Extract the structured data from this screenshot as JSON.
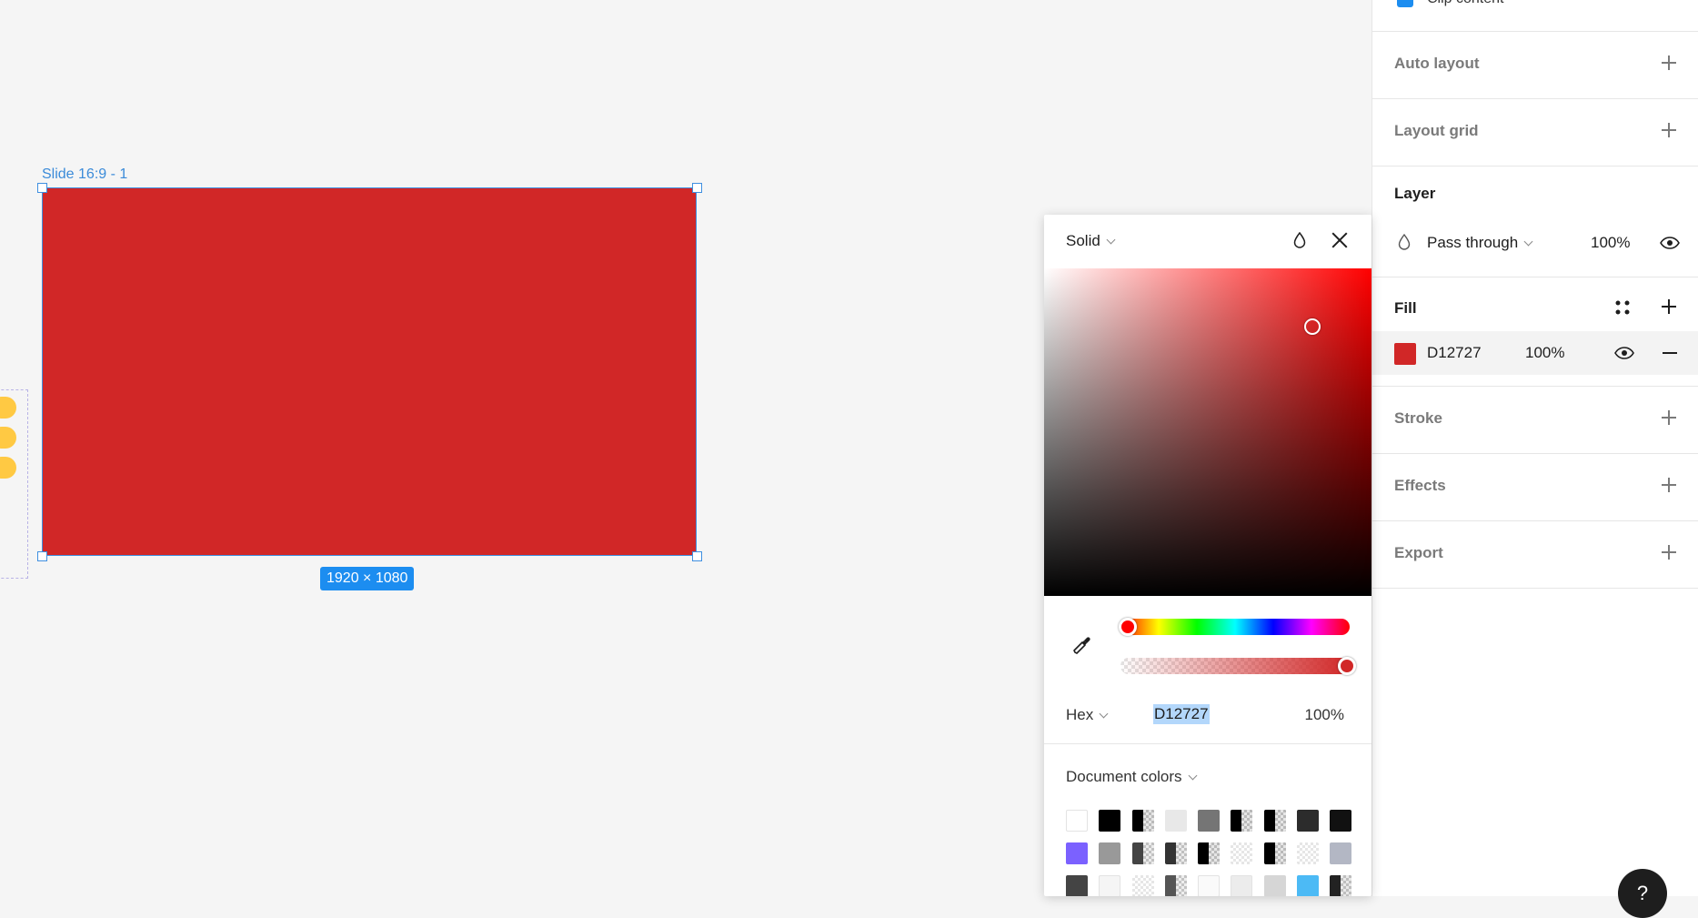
{
  "canvas": {
    "frame_label": "Slide 16:9 - 1",
    "frame_fill": "#d12727",
    "size_badge": "1920 × 1080",
    "selection_color": "#3f8fe0"
  },
  "panel": {
    "clip_content_label": "Clip content",
    "sections": {
      "auto_layout": "Auto layout",
      "layout_grid": "Layout grid",
      "layer": "Layer",
      "fill": "Fill",
      "stroke": "Stroke",
      "effects": "Effects",
      "export": "Export"
    },
    "layer": {
      "blend_mode": "Pass through",
      "opacity": "100%"
    },
    "fill": {
      "hex": "D12727",
      "opacity": "100%",
      "color": "#d12727"
    }
  },
  "picker": {
    "fill_type": "Solid",
    "color_mode": "Hex",
    "hex_value": "D12727",
    "opacity": "100%",
    "library_label": "Document colors",
    "swatches": [
      {
        "color": "#ffffff",
        "style": "light"
      },
      {
        "color": "#000000",
        "style": "solid"
      },
      {
        "color": "#000000",
        "style": "half"
      },
      {
        "color": "#e8e8e8",
        "style": "solid"
      },
      {
        "color": "#757575",
        "style": "solid"
      },
      {
        "color": "#000000",
        "style": "half"
      },
      {
        "color": "#000000",
        "style": "half"
      },
      {
        "color": "#2c2c2c",
        "style": "solid"
      },
      {
        "color": "#111111",
        "style": "solid"
      },
      {
        "color": "#7b61ff",
        "style": "solid"
      },
      {
        "color": "#999999",
        "style": "solid"
      },
      {
        "color": "#444444",
        "style": "half"
      },
      {
        "color": "#333333",
        "style": "half"
      },
      {
        "color": "#000000",
        "style": "half"
      },
      {
        "color": "#ffffff",
        "style": "checker"
      },
      {
        "color": "#000000",
        "style": "half"
      },
      {
        "color": "#ffffff",
        "style": "checker"
      },
      {
        "color": "#b3b7c4",
        "style": "solid"
      },
      {
        "color": "#444444",
        "style": "solid"
      },
      {
        "color": "#f5f5f5",
        "style": "light"
      },
      {
        "color": "#e6e6e6",
        "style": "checker"
      },
      {
        "color": "#555555",
        "style": "half"
      },
      {
        "color": "#fafafa",
        "style": "light"
      },
      {
        "color": "#ececec",
        "style": "light"
      },
      {
        "color": "#d6d6d6",
        "style": "solid"
      },
      {
        "color": "#4cbaf5",
        "style": "solid"
      },
      {
        "color": "#222222",
        "style": "half"
      }
    ]
  },
  "help_label": "?"
}
